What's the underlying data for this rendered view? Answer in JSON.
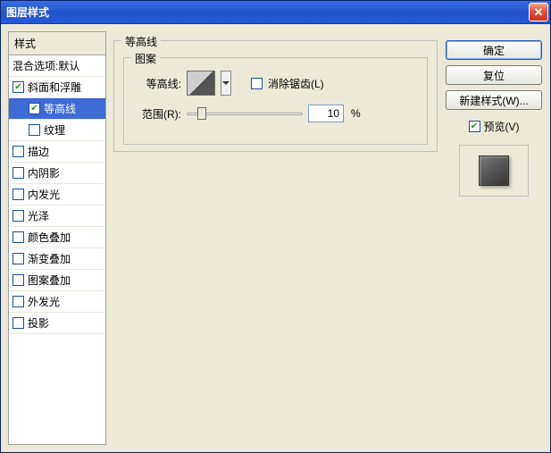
{
  "window": {
    "title": "图层样式"
  },
  "styles": {
    "header": "样式",
    "blend_opts": "混合选项:默认",
    "items": [
      {
        "label": "斜面和浮雕",
        "checked": true,
        "indent": false,
        "selected": false
      },
      {
        "label": "等高线",
        "checked": true,
        "indent": true,
        "selected": true
      },
      {
        "label": "纹理",
        "checked": false,
        "indent": true,
        "selected": false
      },
      {
        "label": "描边",
        "checked": false,
        "indent": false,
        "selected": false
      },
      {
        "label": "内阴影",
        "checked": false,
        "indent": false,
        "selected": false
      },
      {
        "label": "内发光",
        "checked": false,
        "indent": false,
        "selected": false
      },
      {
        "label": "光泽",
        "checked": false,
        "indent": false,
        "selected": false
      },
      {
        "label": "颜色叠加",
        "checked": false,
        "indent": false,
        "selected": false
      },
      {
        "label": "渐变叠加",
        "checked": false,
        "indent": false,
        "selected": false
      },
      {
        "label": "图案叠加",
        "checked": false,
        "indent": false,
        "selected": false
      },
      {
        "label": "外发光",
        "checked": false,
        "indent": false,
        "selected": false
      },
      {
        "label": "投影",
        "checked": false,
        "indent": false,
        "selected": false
      }
    ]
  },
  "panel": {
    "group_title": "等高线",
    "fieldset_title": "图案",
    "contour_label": "等高线:",
    "antialias_label": "消除锯齿(L)",
    "antialias_checked": false,
    "range_label": "范围(R):",
    "range_value": "10",
    "range_unit": "%",
    "slider_pos_pct": 10
  },
  "side": {
    "ok": "确定",
    "cancel": "复位",
    "new_style": "新建样式(W)...",
    "preview_label": "预览(V)",
    "preview_checked": true
  }
}
